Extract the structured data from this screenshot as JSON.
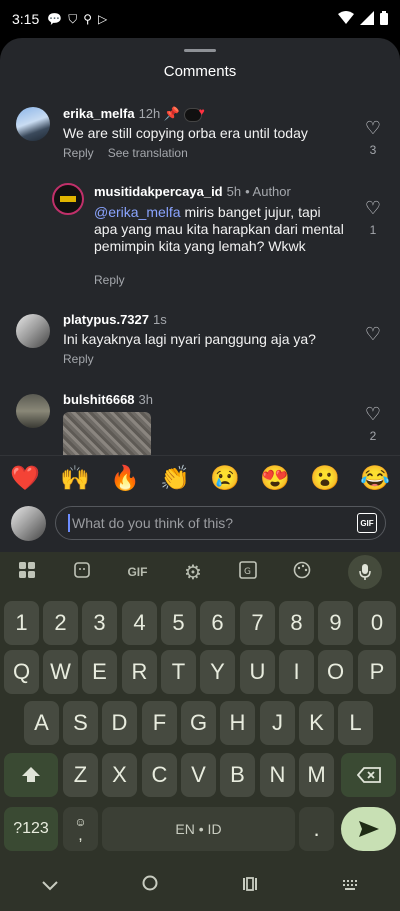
{
  "status": {
    "time": "3:15"
  },
  "sheet": {
    "title": "Comments"
  },
  "comments": [
    {
      "user": "erika_melfa",
      "time": "12h",
      "text": "We are still copying orba era until today",
      "reply": "Reply",
      "translate": "See translation",
      "likes": "3"
    },
    {
      "user": "musitidakpercaya_id",
      "time": "5h",
      "author": "• Author",
      "mention": "@erika_melfa",
      "text": " miris banget jujur, tapi apa yang mau kita harapkan dari mental pemimpin kita yang lemah? Wkwk",
      "reply": "Reply",
      "likes": "1"
    },
    {
      "user": "platypus.7327",
      "time": "1s",
      "text": "Ini kayaknya lagi nyari panggung aja ya?",
      "reply": "Reply"
    },
    {
      "user": "bulshit6668",
      "time": "3h",
      "likes": "2"
    }
  ],
  "emojis": [
    "❤️",
    "🙌",
    "🔥",
    "👏",
    "😢",
    "😍",
    "😮",
    "😂"
  ],
  "input": {
    "placeholder": "What do you think of this?",
    "gif": "GIF"
  },
  "keyboard": {
    "row_numbers": [
      "1",
      "2",
      "3",
      "4",
      "5",
      "6",
      "7",
      "8",
      "9",
      "0"
    ],
    "row1": [
      "Q",
      "W",
      "E",
      "R",
      "T",
      "Y",
      "U",
      "I",
      "O",
      "P"
    ],
    "row2": [
      "A",
      "S",
      "D",
      "F",
      "G",
      "H",
      "J",
      "K",
      "L"
    ],
    "row3": [
      "Z",
      "X",
      "C",
      "V",
      "B",
      "N",
      "M"
    ],
    "symbols": "?123",
    "comma": ",",
    "space": "EN • ID",
    "period": ".",
    "gif_tool": "GIF"
  }
}
